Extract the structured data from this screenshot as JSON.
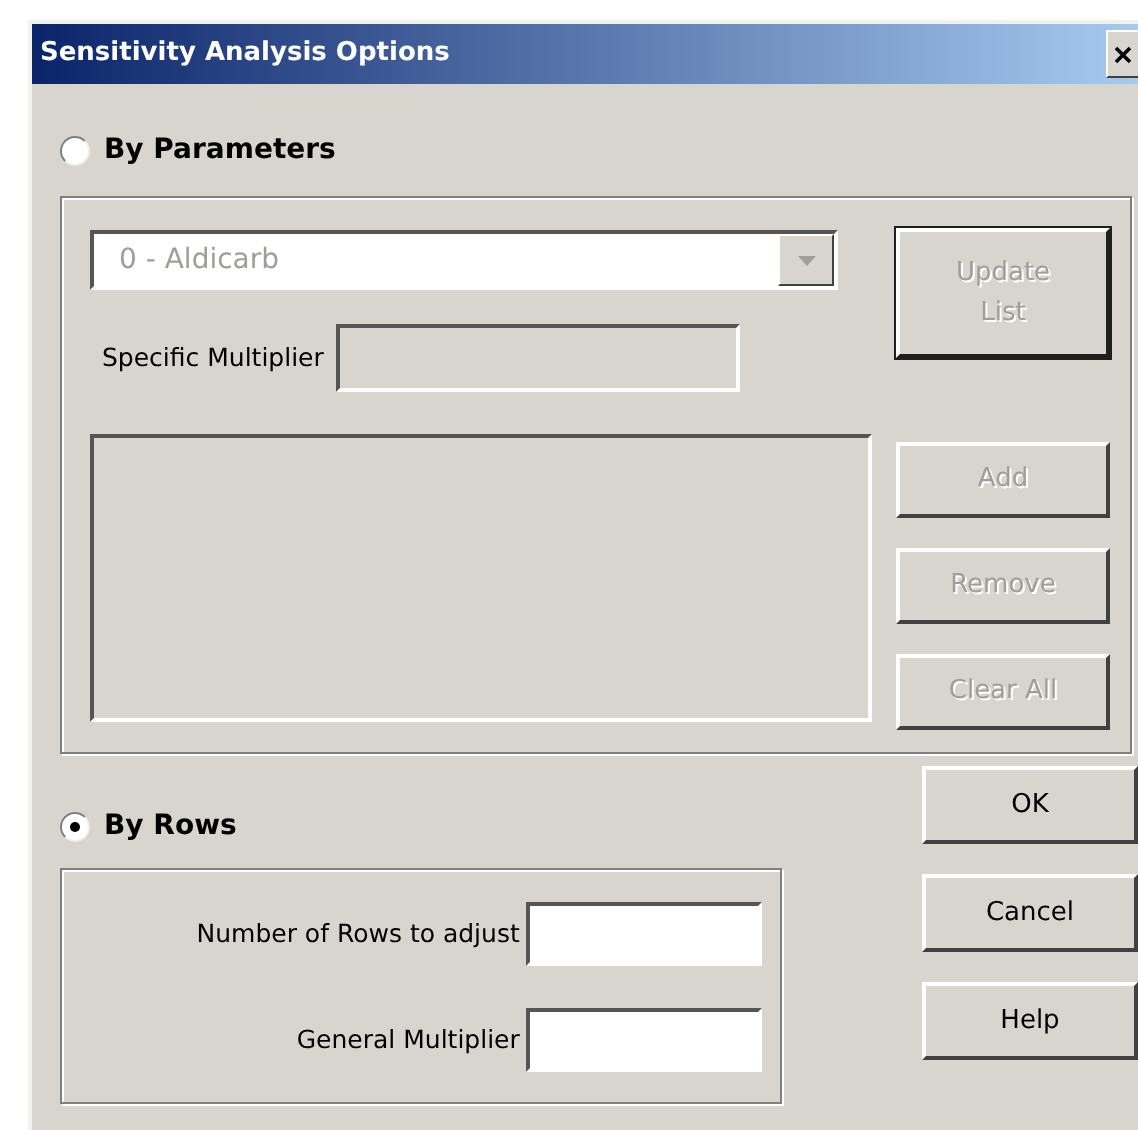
{
  "window": {
    "title": "Sensitivity Analysis Options"
  },
  "modes": [
    {
      "label": "By Parameters",
      "selected": false
    },
    {
      "label": "By Rows",
      "selected": true
    }
  ],
  "parameters": {
    "dropdown": {
      "value": "0 - Aldicarb",
      "disabled": true
    },
    "specific_multiplier": {
      "label": "Specific Multiplier",
      "disabled": true
    },
    "listbox": {
      "disabled": true
    },
    "update_button": {
      "label": "Update List",
      "disabled": true
    },
    "list_buttons": [
      {
        "label": "Add",
        "disabled": true
      },
      {
        "label": "Remove",
        "disabled": true
      },
      {
        "label": "Clear All",
        "disabled": true
      }
    ]
  },
  "rows": {
    "fields": [
      {
        "label": "Number of Rows to adjust"
      },
      {
        "label": "General Multiplier"
      }
    ]
  },
  "buttons": [
    {
      "label": "OK"
    },
    {
      "label": "Cancel"
    },
    {
      "label": "Help"
    }
  ]
}
